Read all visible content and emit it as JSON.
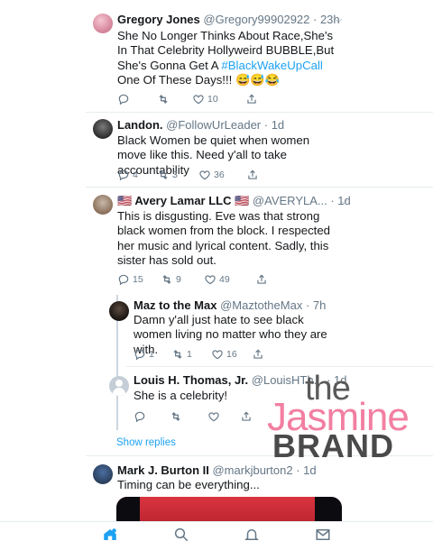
{
  "tweets": [
    {
      "name": "Gregory Jones",
      "handle": "@Gregory99902922",
      "time": "· 23h",
      "text_parts": [
        "She No Longer Thinks About Race,She's In That Celebrity Hollyweird BUBBLE,But She's Gonna Get A ",
        "#BlackWakeUpCall",
        " One Of These Days!!! 😅😅😂"
      ],
      "reply_count": "",
      "retweet_count": "",
      "like_count": "10"
    },
    {
      "name": "Landon.",
      "handle": "@FollowUrLeader",
      "time": "· 1d",
      "text": "Black Women be quiet  when women move like this. Need y'all to take accountability",
      "reply_count": "4",
      "retweet_count": "3",
      "like_count": "36"
    },
    {
      "name": "🇺🇸 Avery Lamar LLC 🇺🇸",
      "handle": "@AVERYLA...",
      "time": "· 1d",
      "text": "This is disgusting. Eve was that strong black women from the block. I respected her music and lyrical content. Sadly, this sister has sold out.",
      "reply_count": "15",
      "retweet_count": "9",
      "like_count": "49"
    },
    {
      "name": "Maz to the Max",
      "handle": "@MaztotheMax",
      "time": "· 7h",
      "text": "Damn y'all just hate to see black women living  no matter who they are with.",
      "reply_count": "1",
      "retweet_count": "1",
      "like_count": "16"
    },
    {
      "name": "Louis H. Thomas, Jr.",
      "handle": "@LouisHTh...",
      "time": "· 1d",
      "text": "She is a celebrity!",
      "reply_count": "",
      "retweet_count": "",
      "like_count": ""
    },
    {
      "name": "Mark J. Burton II",
      "handle": "@markjburton2",
      "time": "· 1d",
      "text": "Timing can be everything..."
    }
  ],
  "show_replies": "Show replies",
  "watermark": {
    "the": "the",
    "jasmine": "Jasmine",
    "brand": "BRAND"
  },
  "colors": {
    "accent": "#1da1f2",
    "muted": "#657786",
    "pink": "#f27fa1"
  },
  "icons": [
    "reply-icon",
    "retweet-icon",
    "like-icon",
    "share-icon",
    "home-icon",
    "search-icon",
    "notifications-icon",
    "messages-icon"
  ]
}
